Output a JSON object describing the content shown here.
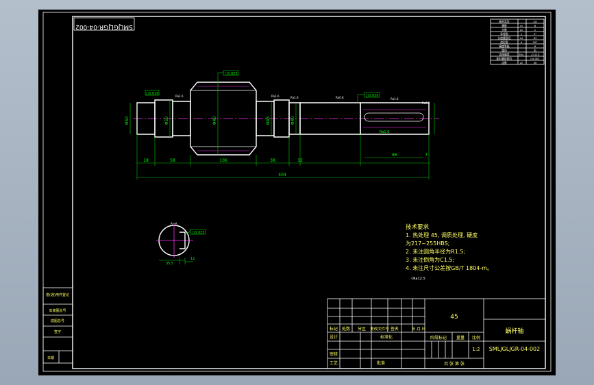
{
  "drawing_number_mirrored": "SMLJGLJGR-04-002",
  "shaft": {
    "tolerance_boxes": [
      "□0.030",
      "□0.025",
      "□0.030",
      "□0.025"
    ],
    "diameters": [
      "Φ50",
      "Φ50",
      "Φ40",
      "Φ45",
      "Φ40"
    ],
    "segment_lengths": [
      "18",
      "58",
      "106",
      "38",
      "32",
      "86",
      "7"
    ],
    "overall_length": "404",
    "roughness": [
      "Ra1.6",
      "Ra1.6",
      "Ra0.8",
      "Ra1.6",
      "Ra1.6",
      "Ra1.6",
      "Ra3.2"
    ]
  },
  "section": {
    "tolerance_box": "□0.025",
    "label_top": "A—A",
    "dim_width": "12",
    "dim_depth": "35.5"
  },
  "technical_requirements": {
    "title": "技术要求",
    "line1": "1. 热处理 45, 调质处理, 硬度",
    "line2": "为217~255HBS;",
    "line3": "2. 未注圆角半径为R1.5;",
    "line4": "3. 未注倒角为C1.5;",
    "line5": "4. 未注尺寸公差按GB/T 1804-m。"
  },
  "general_roughness": "√Ra12.5",
  "parameter_table": {
    "rows": [
      {
        "label": "蜗杆类型",
        "sym": "",
        "val": "ZA"
      },
      {
        "label": "模数",
        "sym": "m",
        "val": "6"
      },
      {
        "label": "头数",
        "sym": "z1",
        "val": "1"
      },
      {
        "label": "导程角",
        "sym": "γ",
        "val": "5°"
      },
      {
        "label": "分度圆直径",
        "sym": "d1",
        "val": "63"
      },
      {
        "label": "齿形角",
        "sym": "α",
        "val": "20°"
      },
      {
        "label": "精度等级",
        "sym": "",
        "val": "8"
      },
      {
        "label": "旋向",
        "sym": "",
        "val": "右"
      },
      {
        "label": "齿厚偏差",
        "sym": "Ess",
        "val": "-0.110"
      },
      {
        "label": "配对蜗轮图号",
        "sym": "",
        "val": "04-001"
      },
      {
        "label": "齿数",
        "sym": "z2",
        "val": "40"
      }
    ]
  },
  "left_strip": [
    "借(通)用件登记",
    "旧底图总号",
    "底图总号",
    "签字",
    "日期"
  ],
  "title_block": {
    "material": "45",
    "part_name": "蜗杆轴",
    "drawing_number": "SMLJGLJGR-04-002",
    "scale": "1:2",
    "row_labels": [
      "标记",
      "处数",
      "分区",
      "更改文件号",
      "签名",
      "年.月.日"
    ],
    "designer": "设计",
    "standardization": "标准化",
    "stage_mark": "阶段标记",
    "weight": "重量",
    "scale_label": "比例",
    "checker": "审核",
    "process": "工艺",
    "approve": "批准",
    "sheets": "共    张    第    张"
  }
}
